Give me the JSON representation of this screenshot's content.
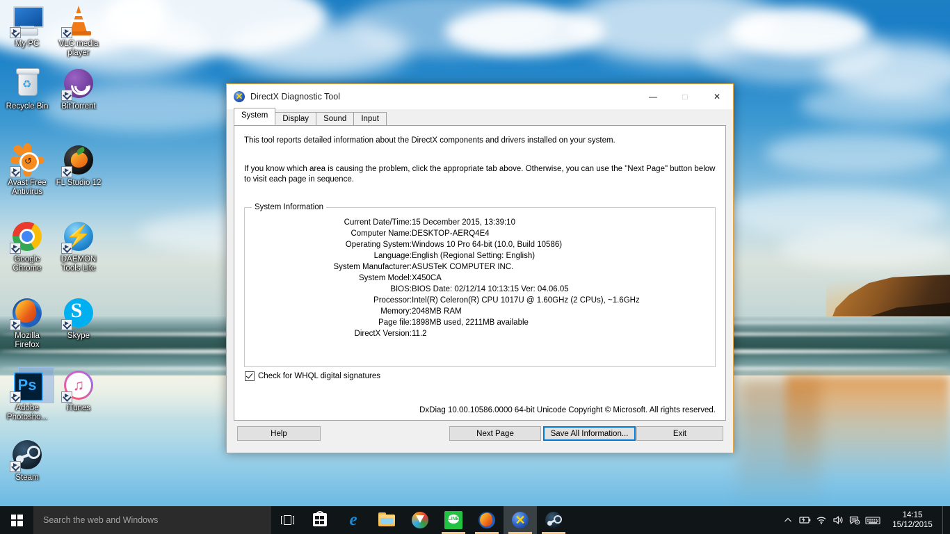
{
  "desktop": {
    "icons": [
      {
        "label": "My PC",
        "art": "my-pc"
      },
      {
        "label": "VLC media player",
        "art": "vlc"
      },
      {
        "label": "Recycle Bin",
        "art": "recycle-bin"
      },
      {
        "label": "BitTorrent",
        "art": "bittorrent"
      },
      {
        "label": "Avast Free Antivirus",
        "art": "avast"
      },
      {
        "label": "FL Studio 12",
        "art": "fl-studio"
      },
      {
        "label": "Google Chrome",
        "art": "chrome"
      },
      {
        "label": "DAEMON Tools Lite",
        "art": "daemon-tools"
      },
      {
        "label": "Mozilla Firefox",
        "art": "firefox"
      },
      {
        "label": "Skype",
        "art": "skype"
      },
      {
        "label": "Adobe Photosho...",
        "art": "photoshop"
      },
      {
        "label": "iTunes",
        "art": "itunes"
      },
      {
        "label": "Steam",
        "art": "steam"
      }
    ]
  },
  "window": {
    "title": "DirectX Diagnostic Tool",
    "app_icon": "directx-icon",
    "minimize_label": "—",
    "maximize_label": "□",
    "close_label": "✕",
    "tabs": [
      {
        "label": "System",
        "active": true
      },
      {
        "label": "Display",
        "active": false
      },
      {
        "label": "Sound",
        "active": false
      },
      {
        "label": "Input",
        "active": false
      }
    ],
    "description_1": "This tool reports detailed information about the DirectX components and drivers installed on your system.",
    "description_2": "If you know which area is causing the problem, click the appropriate tab above.  Otherwise, you can use the \"Next Page\" button below to visit each page in sequence.",
    "system_information": {
      "legend": "System Information",
      "rows": [
        {
          "key": "Current Date/Time:",
          "value": "15 December 2015, 13:39:10"
        },
        {
          "key": "Computer Name:",
          "value": "DESKTOP-AERQ4E4"
        },
        {
          "key": "Operating System:",
          "value": "Windows 10 Pro 64-bit (10.0, Build 10586)"
        },
        {
          "key": "Language:",
          "value": "English (Regional Setting: English)"
        },
        {
          "key": "System Manufacturer:",
          "value": "ASUSTeK COMPUTER INC."
        },
        {
          "key": "System Model:",
          "value": "X450CA"
        },
        {
          "key": "BIOS:",
          "value": "BIOS Date: 02/12/14 10:13:15 Ver: 04.06.05"
        },
        {
          "key": "Processor:",
          "value": "Intel(R) Celeron(R) CPU 1017U @ 1.60GHz (2 CPUs), ~1.6GHz"
        },
        {
          "key": "Memory:",
          "value": "2048MB RAM"
        },
        {
          "key": "Page file:",
          "value": "1898MB used, 2211MB available"
        },
        {
          "key": "DirectX Version:",
          "value": "11.2"
        }
      ]
    },
    "whql_checkbox": {
      "label": "Check for WHQL digital signatures",
      "checked": true
    },
    "copyright": "DxDiag 10.00.10586.0000 64-bit Unicode  Copyright © Microsoft. All rights reserved.",
    "buttons": {
      "help": "Help",
      "next_page": "Next Page",
      "save_all": "Save All Information...",
      "exit": "Exit"
    },
    "focus_accent_color": "#0078d7",
    "border_color": "#e8a33d"
  },
  "taskbar": {
    "start_icon": "windows-logo-icon",
    "search_placeholder": "Search the web and Windows",
    "task_view_icon": "task-view-icon",
    "apps": [
      {
        "name": "microsoft-store",
        "running": false,
        "active": false
      },
      {
        "name": "microsoft-edge",
        "running": false,
        "active": false
      },
      {
        "name": "file-explorer",
        "running": false,
        "active": false
      },
      {
        "name": "internet-download-manager",
        "running": false,
        "active": false
      },
      {
        "name": "line",
        "running": true,
        "active": false
      },
      {
        "name": "mozilla-firefox",
        "running": true,
        "active": false
      },
      {
        "name": "directx-diagnostic-tool",
        "running": true,
        "active": true
      },
      {
        "name": "steam",
        "running": true,
        "active": false
      }
    ],
    "tray": [
      {
        "name": "show-hidden-icons",
        "glyph": "⌃"
      },
      {
        "name": "battery-charging-icon",
        "glyph": "battery"
      },
      {
        "name": "wifi-icon",
        "glyph": "wifi"
      },
      {
        "name": "volume-icon",
        "glyph": "volume"
      },
      {
        "name": "action-center-icon",
        "glyph": "action"
      },
      {
        "name": "keyboard-icon",
        "glyph": "keyboard"
      }
    ],
    "clock": {
      "time": "14:15",
      "date": "15/12/2015"
    }
  }
}
